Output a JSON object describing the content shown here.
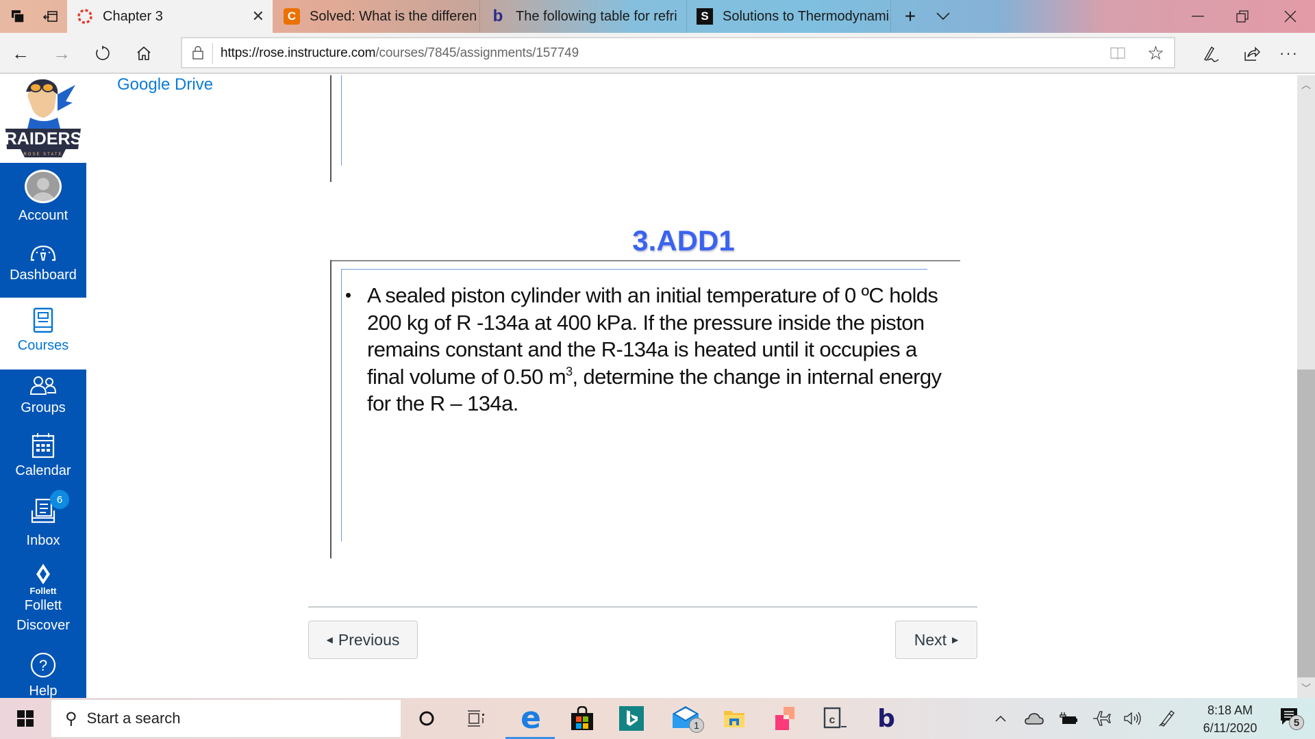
{
  "browser": {
    "tabs": [
      {
        "title": "Chapter 3",
        "favicon": "canvas-icon",
        "active": true
      },
      {
        "title": "Solved: What is the differen",
        "favicon": "chegg-icon",
        "active": false
      },
      {
        "title": "The following table for refri",
        "favicon": "bartleby-icon",
        "active": false
      },
      {
        "title": "Solutions to Thermodynami",
        "favicon": "slader-icon",
        "active": false
      }
    ],
    "new_tab_symbol": "+",
    "tab_list_symbol": "⌵",
    "url_host": "https://rose.instructure.com",
    "url_path": "/courses/7845/assignments/157749",
    "window_controls": {
      "minimize": "—",
      "restore": "❐",
      "close": "✕"
    },
    "toolbar_symbols": {
      "back": "←",
      "forward": "→",
      "refresh": "↻",
      "home": "⌂",
      "favorite": "☆",
      "notes": "✍",
      "share": "⇪",
      "more": "···"
    }
  },
  "sidebar": {
    "logo_text": "RAIDERS",
    "logo_subtext": "ROSE STATE",
    "items": [
      {
        "label": "Account",
        "icon": "avatar-icon",
        "active": false
      },
      {
        "label": "Dashboard",
        "icon": "dashboard-icon",
        "active": false
      },
      {
        "label": "Courses",
        "icon": "courses-icon",
        "active": true
      },
      {
        "label": "Groups",
        "icon": "groups-icon",
        "active": false
      },
      {
        "label": "Calendar",
        "icon": "calendar-icon",
        "active": false
      },
      {
        "label": "Inbox",
        "icon": "inbox-icon",
        "active": false,
        "badge": "6"
      },
      {
        "label": "Follett Discover",
        "icon": "follett-icon",
        "active": false,
        "icon_caption": "Follett"
      },
      {
        "label": "Help",
        "icon": "help-icon",
        "active": false
      }
    ],
    "colors": {
      "background": "#0355b5",
      "active_text": "#0374d4"
    }
  },
  "content": {
    "top_link": "Google Drive",
    "slide_title": "3.ADD1",
    "slide_text_before_sup": "A sealed piston cylinder with an initial temperature of 0 ºC holds 200 kg of R -134a at 400 kPa. If the pressure inside the piston remains constant and the R-134a is heated until it occupies a final volume of 0.50 m",
    "slide_sup": "3",
    "slide_text_after_sup": ", determine the change in internal energy for the R – 134a.",
    "bullet": "•",
    "previous_label": "Previous",
    "next_label": "Next",
    "title_color": "#3b63ef"
  },
  "taskbar": {
    "search_placeholder": "Start a search",
    "pinned": [
      "cortana-icon",
      "task-view-icon",
      "edge-icon",
      "store-icon",
      "bing-icon",
      "mail-icon",
      "file-explorer-icon",
      "snip-sketch-icon",
      "terminal-icon",
      "bartleby-icon"
    ],
    "mail_badge": "1",
    "time": "8:18 AM",
    "date": "6/11/2020",
    "notifications_count": "5"
  }
}
